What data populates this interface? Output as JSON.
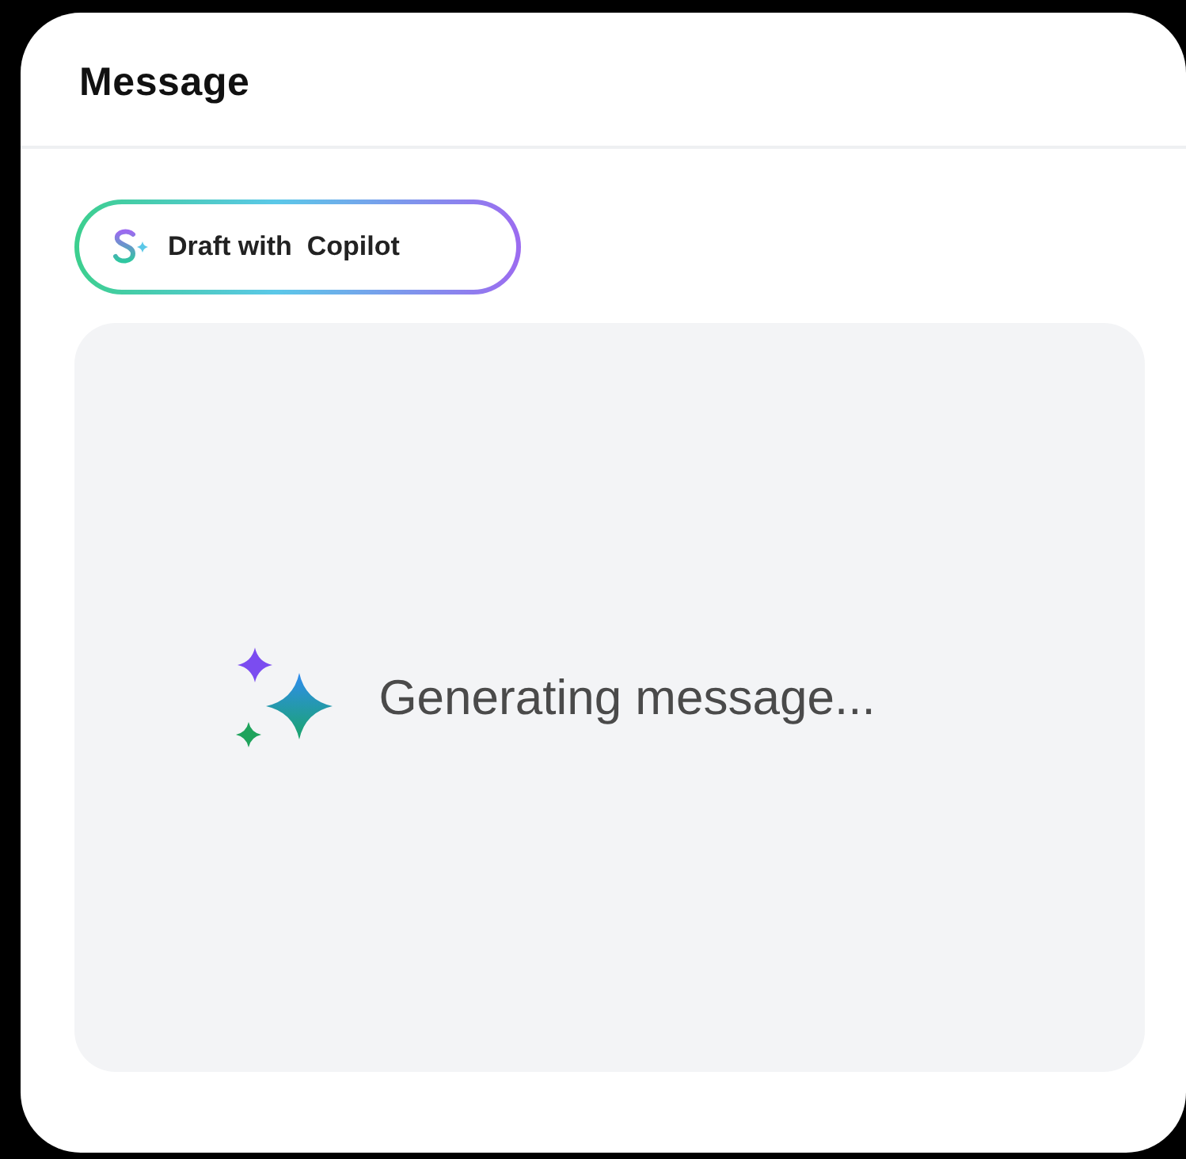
{
  "panel": {
    "title": "Message"
  },
  "draft_button": {
    "label": "Draft with  Copilot"
  },
  "status": {
    "text": "Generating message..."
  }
}
